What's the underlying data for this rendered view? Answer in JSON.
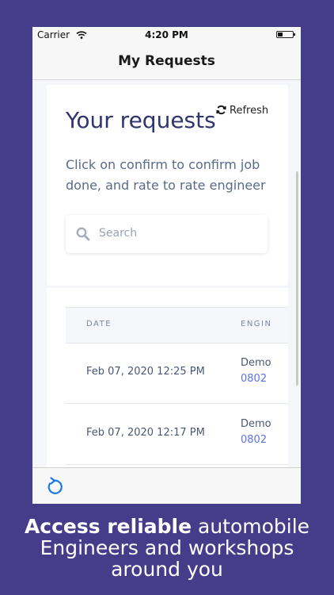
{
  "status_bar": {
    "carrier": "Carrier",
    "time": "4:20 PM"
  },
  "nav": {
    "title": "My Requests"
  },
  "requests": {
    "heading": "Your requests",
    "refresh_label": "Refresh",
    "description": "Click on confirm to confirm job done, and rate to rate engineer",
    "search_placeholder": "Search"
  },
  "table": {
    "columns": [
      "DATE",
      "ENGIN"
    ],
    "rows": [
      {
        "date": "Feb 07, 2020 12:25 PM",
        "engineer": "Demo",
        "phone": "0802"
      },
      {
        "date": "Feb 07, 2020 12:17 PM",
        "engineer": "Demo",
        "phone": "0802"
      }
    ]
  },
  "caption": {
    "bold": "Access reliable",
    "line1_rest": " automobile",
    "line2": "Engineers and workshops",
    "line3": "around you"
  },
  "colors": {
    "background": "#453d8a",
    "heading": "#30356b",
    "link": "#5e72e4",
    "toolbar_icon": "#1e7ae0"
  }
}
